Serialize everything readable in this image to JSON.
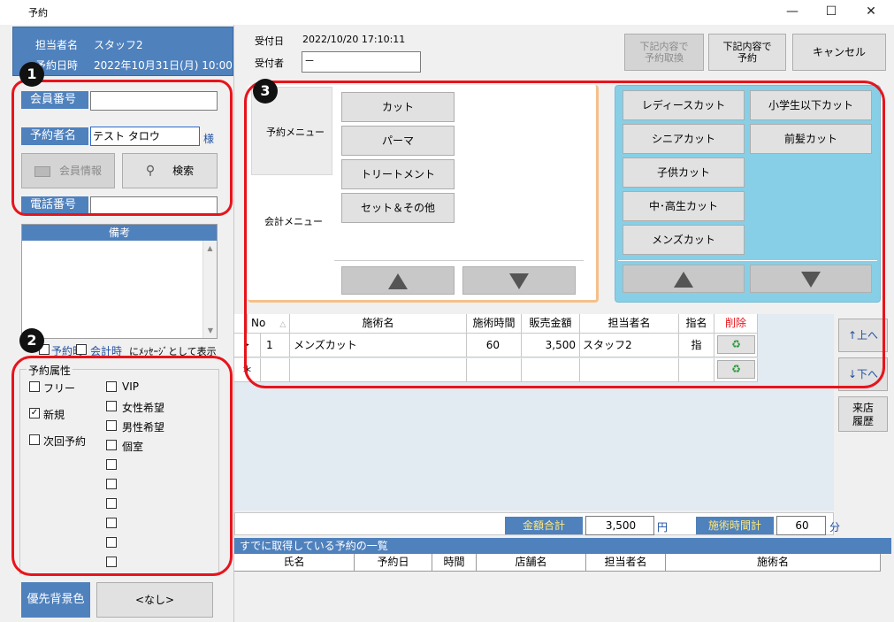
{
  "window": {
    "title": "予約",
    "minimize": "—",
    "maximize": "☐",
    "close": "✕"
  },
  "header": {
    "staff_label": "担当者名",
    "staff_value": "スタッフ2",
    "date_label": "予約日時",
    "date_value": "2022年10月31日(月) 10:00"
  },
  "reception": {
    "date_label": "受付日",
    "date_value": "2022/10/20 17:10:11",
    "person_label": "受付者",
    "person_value": "－"
  },
  "top_buttons": {
    "replace": "下記内容で\n予約取換",
    "reserve": "下記内容で\n予約",
    "cancel": "キャンセル"
  },
  "member": {
    "number_label": "会員番号",
    "number_value": "",
    "name_label": "予約者名",
    "name_value": "テスト タロウ",
    "honorific": "様",
    "info_button": "会員情報",
    "search_button": "検索",
    "phone_label": "電話番号",
    "phone_value": ""
  },
  "remarks": {
    "title": "備考",
    "value": "",
    "msg_reserve": "予約時",
    "msg_account": "会計時",
    "msg_suffix": "にﾒｯｾｰｼﾞとして表示"
  },
  "attributes": {
    "title": "予約属性",
    "left": [
      {
        "label": "フリー",
        "checked": false
      },
      {
        "label": "新規",
        "checked": true
      },
      {
        "label": "次回予約",
        "checked": false
      }
    ],
    "right": [
      {
        "label": "VIP",
        "checked": false
      },
      {
        "label": "女性希望",
        "checked": false
      },
      {
        "label": "男性希望",
        "checked": false
      },
      {
        "label": "個室",
        "checked": false
      },
      {
        "label": "",
        "checked": false
      },
      {
        "label": "",
        "checked": false
      },
      {
        "label": "",
        "checked": false
      },
      {
        "label": "",
        "checked": false
      },
      {
        "label": "",
        "checked": false
      },
      {
        "label": "",
        "checked": false
      }
    ]
  },
  "priority": {
    "label": "優先背景色",
    "value": "<なし>"
  },
  "badges": [
    "1",
    "2",
    "3"
  ],
  "menu": {
    "reserve_menu_label": "予約メニュー",
    "account_menu_label": "会計メニュー",
    "categories": [
      "カット",
      "パーマ",
      "トリートメント",
      "セット＆その他"
    ],
    "items_col1": [
      "レディースカット",
      "シニアカット",
      "子供カット",
      "中･高生カット",
      "メンズカット"
    ],
    "items_col2": [
      "小学生以下カット",
      "前髪カット"
    ]
  },
  "grid": {
    "headers": {
      "no": "No",
      "name": "施術名",
      "time": "施術時間",
      "price": "販売金額",
      "staff": "担当者名",
      "nominate": "指名",
      "delete": "削除"
    },
    "rows": [
      {
        "marker": "▸",
        "no": "1",
        "name": "メンズカット",
        "time": "60",
        "price": "3,500",
        "staff": "スタッフ2",
        "nominate": "指"
      }
    ],
    "new_row_marker": "＊"
  },
  "side_buttons": {
    "up": "↑上へ",
    "down": "↓下へ",
    "history": "来店\n履歴"
  },
  "totals": {
    "amount_label": "金額合計",
    "amount_value": "3,500",
    "amount_unit": "円",
    "time_label": "施術時間計",
    "time_value": "60",
    "time_unit": "分"
  },
  "existing": {
    "title": "すでに取得している予約の一覧",
    "headers": {
      "name": "氏名",
      "date": "予約日",
      "time": "時間",
      "store": "店舗名",
      "staff": "担当者名",
      "treatment": "施術名"
    }
  },
  "colors": {
    "accent": "#4f81bd",
    "ring": "#e8141c",
    "panel_blue": "#87cfe6",
    "delete_red": "#e8141c"
  }
}
